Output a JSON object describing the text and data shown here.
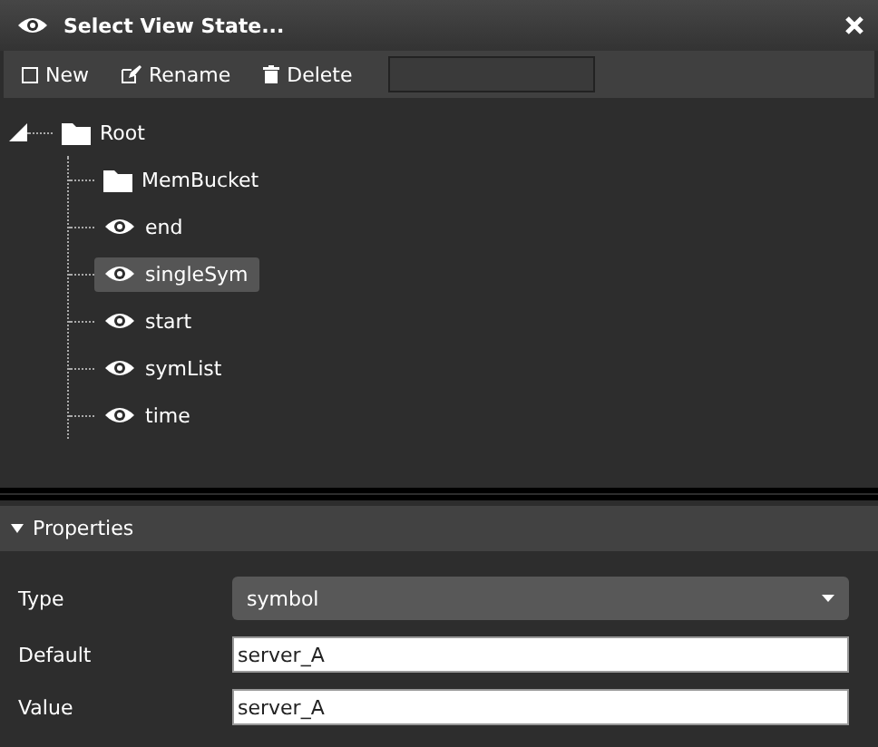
{
  "window": {
    "title": "Select View State..."
  },
  "toolbar": {
    "buttons": [
      {
        "kind": "new",
        "label": "New"
      },
      {
        "kind": "rename",
        "label": "Rename"
      },
      {
        "kind": "delete",
        "label": "Delete"
      }
    ]
  },
  "tree": {
    "label": "Root",
    "kind": "folder",
    "expanded": true,
    "selected": false,
    "children": [
      {
        "label": "MemBucket",
        "kind": "folder",
        "selected": false
      },
      {
        "label": "end",
        "kind": "state",
        "selected": false
      },
      {
        "label": "singleSym",
        "kind": "state",
        "selected": true
      },
      {
        "label": "start",
        "kind": "state",
        "selected": false
      },
      {
        "label": "symList",
        "kind": "state",
        "selected": false
      },
      {
        "label": "time",
        "kind": "state",
        "selected": false
      }
    ]
  },
  "properties": {
    "title": "Properties",
    "expanded": true,
    "fields": [
      {
        "kind": "select",
        "label": "Type",
        "value": "symbol"
      },
      {
        "kind": "text",
        "label": "Default",
        "value": "server_A"
      },
      {
        "kind": "text",
        "label": "Value",
        "value": "server_A"
      }
    ]
  }
}
